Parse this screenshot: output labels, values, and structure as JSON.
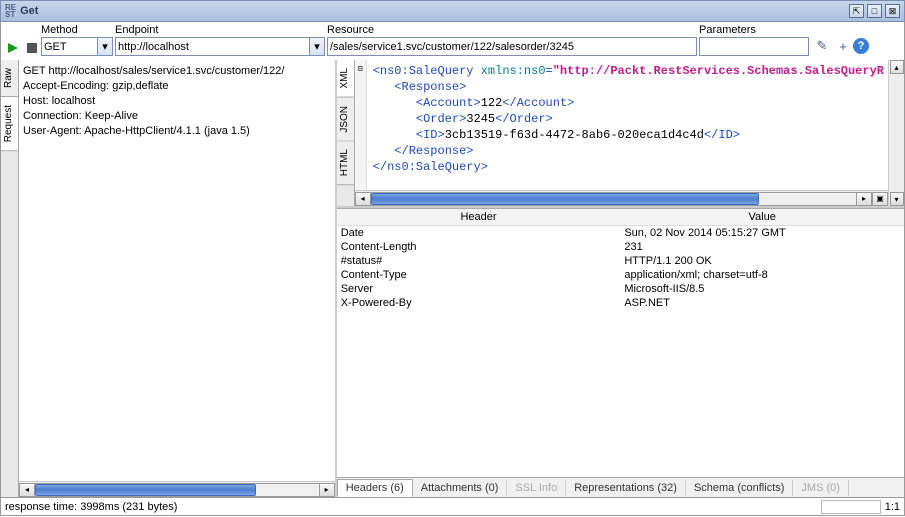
{
  "title": "Get",
  "labels": {
    "method": "Method",
    "endpoint": "Endpoint",
    "resource": "Resource",
    "parameters": "Parameters"
  },
  "method": "GET",
  "endpoint": "http://localhost",
  "resource": "/sales/service1.svc/customer/122/salesorder/3245",
  "parameters": "",
  "request_lines": [
    "GET http://localhost/sales/service1.svc/customer/122/",
    "Accept-Encoding: gzip,deflate",
    "Host: localhost",
    "Connection: Keep-Alive",
    "User-Agent: Apache-HttpClient/4.1.1 (java 1.5)"
  ],
  "left_tabs": [
    "Raw",
    "Request"
  ],
  "right_tabs": [
    "HTML",
    "JSON",
    "XML"
  ],
  "xml": {
    "root_open_a": "<ns0:SaleQuery ",
    "root_attr_name": "xmlns:ns0",
    "root_attr_eq": "=",
    "root_attr_val": "\"http://Packt.RestServices.Schemas.SalesQueryR",
    "resp_open": "<Response>",
    "acct_open": "<Account>",
    "acct_val": "122",
    "acct_close": "</Account>",
    "ord_open": "<Order>",
    "ord_val": "3245",
    "ord_close": "</Order>",
    "id_open": "<ID>",
    "id_val": "3cb13519-f63d-4472-8ab6-020eca1d4c4d",
    "id_close": "</ID>",
    "resp_close": "</Response>",
    "root_close": "</ns0:SaleQuery>"
  },
  "headers_header": {
    "h": "Header",
    "v": "Value"
  },
  "headers": [
    {
      "h": "Date",
      "v": "Sun, 02 Nov 2014 05:15:27 GMT"
    },
    {
      "h": "Content-Length",
      "v": "231"
    },
    {
      "h": "#status#",
      "v": "HTTP/1.1 200 OK"
    },
    {
      "h": "Content-Type",
      "v": "application/xml; charset=utf-8"
    },
    {
      "h": "Server",
      "v": "Microsoft-IIS/8.5"
    },
    {
      "h": "X-Powered-By",
      "v": "ASP.NET"
    }
  ],
  "bottom_tabs": [
    {
      "label": "Headers (6)",
      "active": true
    },
    {
      "label": "Attachments (0)"
    },
    {
      "label": "SSL Info",
      "disabled": true
    },
    {
      "label": "Representations (32)"
    },
    {
      "label": "Schema (conflicts)"
    },
    {
      "label": "JMS (0)",
      "disabled": true
    }
  ],
  "status": {
    "left": "response time: 3998ms (231 bytes)",
    "right": "1:1"
  }
}
